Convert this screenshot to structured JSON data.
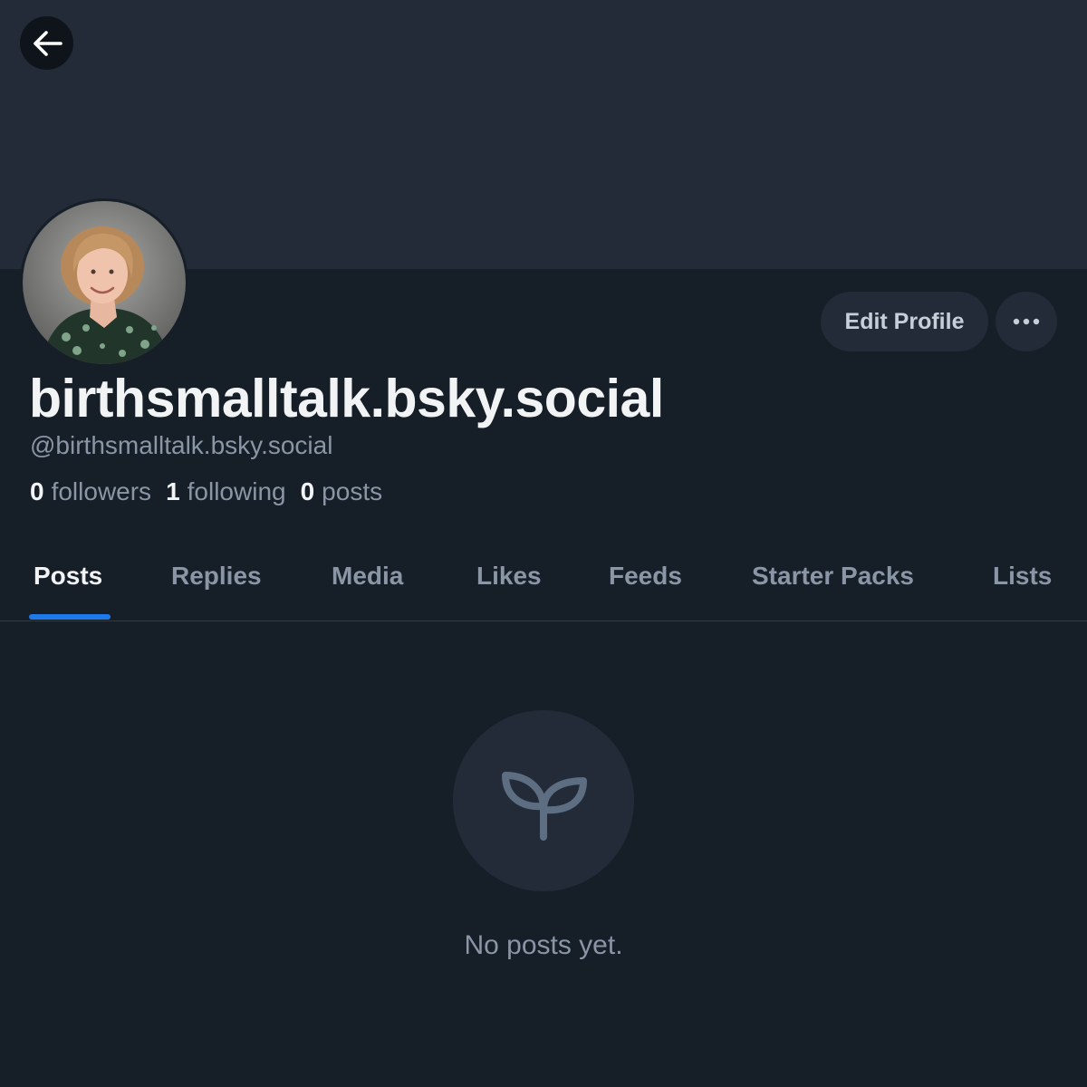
{
  "header": {
    "back_icon": "arrow-left-icon"
  },
  "profile": {
    "display_name": "birthsmalltalk.bsky.social",
    "handle": "@birthsmalltalk.bsky.social",
    "avatar_icon": "profile-photo",
    "edit_button_label": "Edit Profile",
    "more_icon": "ellipsis-icon"
  },
  "stats": {
    "followers_count": "0",
    "followers_label": "followers",
    "following_count": "1",
    "following_label": "following",
    "posts_count": "0",
    "posts_label": "posts"
  },
  "tabs": [
    {
      "label": "Posts",
      "active": true
    },
    {
      "label": "Replies",
      "active": false
    },
    {
      "label": "Media",
      "active": false
    },
    {
      "label": "Likes",
      "active": false
    },
    {
      "label": "Feeds",
      "active": false
    },
    {
      "label": "Starter Packs",
      "active": false
    },
    {
      "label": "Lists",
      "active": false
    }
  ],
  "empty_state": {
    "icon": "seedling-icon",
    "message": "No posts yet."
  },
  "colors": {
    "background": "#161e27",
    "banner": "#232b38",
    "accent": "#1e7ae8",
    "muted_text": "#8a96a6"
  }
}
